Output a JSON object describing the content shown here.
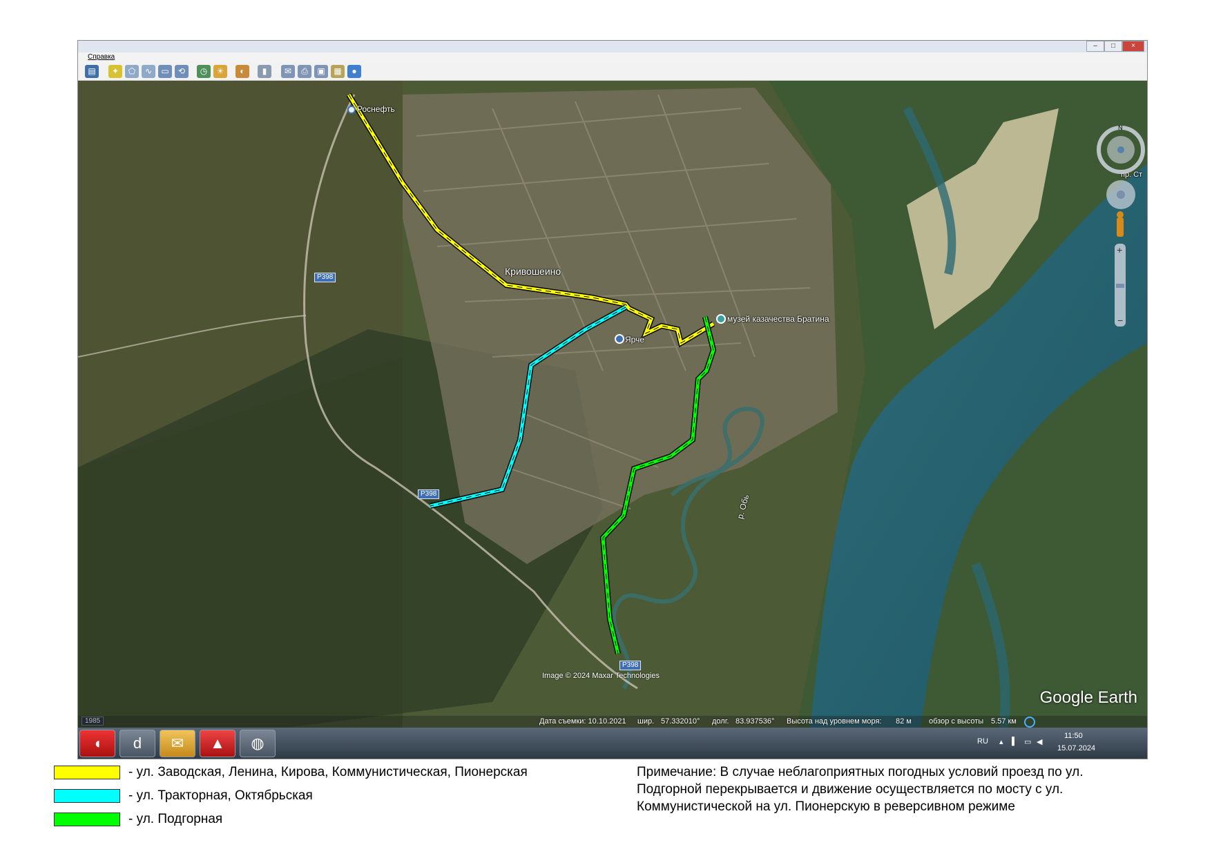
{
  "window": {
    "menu": [
      "Справка"
    ],
    "controls": [
      "minimize",
      "maximize",
      "close"
    ]
  },
  "toolbar": {
    "icons": [
      "sidebar-toggle-icon",
      "add-placemark-icon",
      "add-polygon-icon",
      "add-path-icon",
      "add-overlay-icon",
      "record-tour-icon",
      "historical-imagery-icon",
      "sunlight-icon",
      "planets-icon",
      "ruler-icon",
      "email-icon",
      "print-icon",
      "save-image-icon",
      "view-in-maps-icon",
      "sky-icon"
    ]
  },
  "map": {
    "labels": {
      "rosneft": "Роснефть",
      "town": "Кривошеино",
      "museum": "музей казачества Братина",
      "yarche": "Ярче",
      "river": "р. Обь",
      "edge_label": "пр. Ст"
    },
    "road_tags": [
      "Р398",
      "Р398",
      "Р398"
    ],
    "credit": "Image © 2024 Maxar Technologies",
    "logo": "Google Earth",
    "routes": [
      {
        "name": "ул. Заводская, Ленина, Кирова, Коммунистическая, Пионерская",
        "color": "#ffff00"
      },
      {
        "name": "ул. Тракторная, Октябрьская",
        "color": "#00ffff"
      },
      {
        "name": "ул. Подгорная",
        "color": "#00ff00"
      }
    ]
  },
  "status": {
    "history_year": "1985",
    "date": "Дата съемки: 10.10.2021",
    "lat_label": "шир.",
    "lat": "57.332010°",
    "lon_label": "долг.",
    "lon": "83.937536°",
    "elev_label": "Высота над уровнем моря:",
    "elev": "82 м",
    "eye_label": "обзор с высоты",
    "eye": "5.57 км"
  },
  "taskbar": {
    "apps": [
      "app-red-icon",
      "app-d-icon",
      "app-mail-icon",
      "app-autocad-icon",
      "app-google-earth-pro-icon"
    ],
    "lang": "RU",
    "time": "11:50",
    "date": "15.07.2024"
  },
  "legend": [
    {
      "color": "#ffff00",
      "text": "- ул. Заводская, Ленина, Кирова, Коммунистическая, Пионерская"
    },
    {
      "color": "#00ffff",
      "text": "- ул. Тракторная, Октябрьская"
    },
    {
      "color": "#00ff00",
      "text": "- ул. Подгорная"
    }
  ],
  "note": {
    "line1": "Примечание: В случае неблагоприятных погодных условий проезд по ул.",
    "line2": "Подгорной перекрывается и движение осуществляется по мосту с ул.",
    "line3": "Коммунистической на ул. Пионерскую в реверсивном режиме"
  }
}
